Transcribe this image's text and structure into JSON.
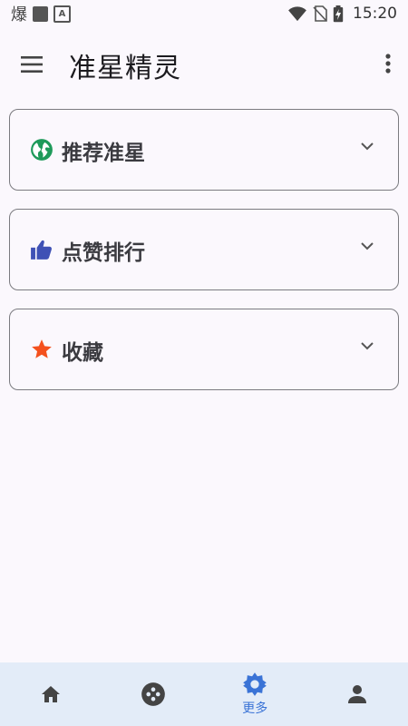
{
  "status_bar": {
    "notification_char": "爆",
    "time": "15:20"
  },
  "app_bar": {
    "title": "准星精灵"
  },
  "sections": [
    {
      "label": "推荐准星",
      "icon": "globe-icon",
      "icon_color": "#1e9a5a"
    },
    {
      "label": "点赞排行",
      "icon": "thumbs-up-icon",
      "icon_color": "#3f51b5"
    },
    {
      "label": "收藏",
      "icon": "star-icon",
      "icon_color": "#f4511e"
    }
  ],
  "bottom_nav": {
    "items": [
      {
        "icon": "home-icon",
        "label": "",
        "active": false
      },
      {
        "icon": "game-icon",
        "label": "",
        "active": false
      },
      {
        "icon": "gear-icon",
        "label": "更多",
        "active": true
      },
      {
        "icon": "person-icon",
        "label": "",
        "active": false
      }
    ]
  },
  "colors": {
    "background": "#fbf8fd",
    "card_border": "#7b7b80",
    "nav_background": "#e3ecf8",
    "nav_active": "#3a73d6",
    "nav_inactive": "#444444"
  }
}
